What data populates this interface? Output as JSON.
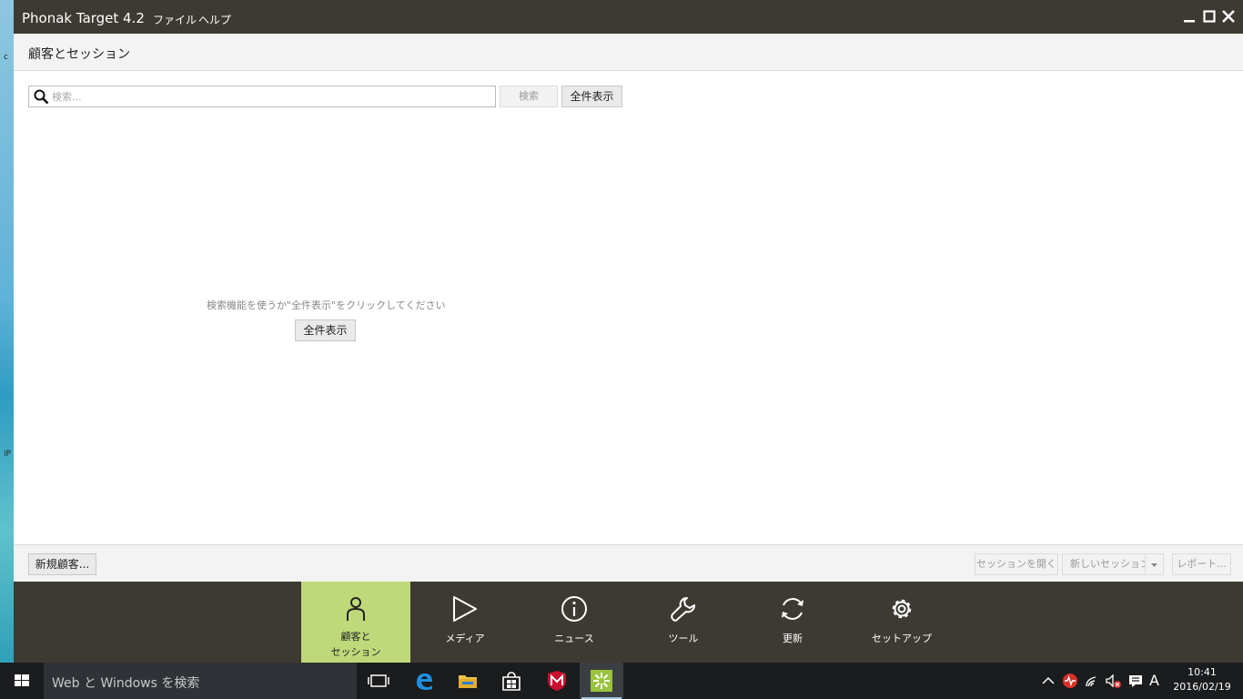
{
  "window": {
    "title": "Phonak Target 4.2",
    "menu": [
      "ファイル",
      "ヘルプ"
    ]
  },
  "section": {
    "title": "顧客とセッション"
  },
  "search": {
    "placeholder": "検索...",
    "search_button": "検索",
    "show_all_button": "全件表示"
  },
  "empty_state": {
    "hint": "検索機能を使うか\"全件表示\"をクリックしてください",
    "show_all_button": "全件表示"
  },
  "footer": {
    "new_client": "新規顧客...",
    "open_session": "セッションを開く",
    "new_session": "新しいセッション",
    "report": "レポート..."
  },
  "nav": {
    "items": [
      {
        "label": "顧客と\nセッション",
        "icon": "person-icon",
        "active": true
      },
      {
        "label": "メディア",
        "icon": "play-icon",
        "active": false
      },
      {
        "label": "ニュース",
        "icon": "info-icon",
        "active": false
      },
      {
        "label": "ツール",
        "icon": "wrench-icon",
        "active": false
      },
      {
        "label": "更新",
        "icon": "refresh-icon",
        "active": false
      },
      {
        "label": "セットアップ",
        "icon": "gear-icon",
        "active": false
      }
    ]
  },
  "taskbar": {
    "search_placeholder": "Web と Windows を検索",
    "ime": "A",
    "time": "10:41",
    "date": "2016/02/19"
  },
  "desktop": {
    "edge_labels": [
      "c",
      "iP"
    ]
  },
  "colors": {
    "titlebar": "#3c3a32",
    "nav_active": "#bfd97a",
    "taskbar": "#1a1c1e"
  }
}
